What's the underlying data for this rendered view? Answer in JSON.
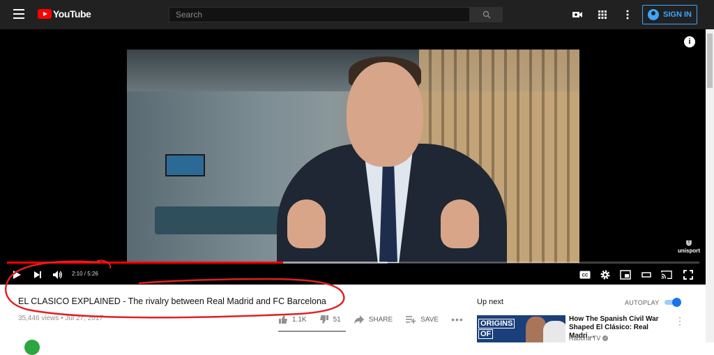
{
  "header": {
    "logo_text": "YouTube",
    "search_placeholder": "Search",
    "sign_in_label": "SIGN IN",
    "icons": [
      "menu-icon",
      "search-icon",
      "create-video-icon",
      "apps-icon",
      "more-vert-icon",
      "account-circle-icon"
    ]
  },
  "player": {
    "time_display": "2:10 / 5:26",
    "progress_fraction": 0.399,
    "buffered_fraction": 0.55,
    "watermark": "unisport",
    "info_icon": "i",
    "controls": [
      "play-icon",
      "next-icon",
      "volume-icon",
      "captions-icon",
      "settings-icon",
      "miniplayer-icon",
      "theater-icon",
      "cast-icon",
      "fullscreen-icon"
    ],
    "captions_label": "CC"
  },
  "video": {
    "title": "EL CLASICO EXPLAINED - The rivalry between Real Madrid and FC Barcelona",
    "meta": "35,446 views • Jul 27, 2017",
    "like_count": "1.1K",
    "dislike_count": "51",
    "share_label": "SHARE",
    "save_label": "SAVE",
    "more_label": "•••"
  },
  "sidebar": {
    "up_next_label": "Up next",
    "autoplay_label": "AUTOPLAY",
    "autoplay_on": true,
    "recommendation": {
      "thumbnail_text_1": "ORIGINS",
      "thumbnail_text_2": "OF",
      "title": "How The Spanish Civil War Shaped El Clásico: Real Madri…",
      "channel": "Rabona TV"
    }
  },
  "colors": {
    "header_bg": "#212121",
    "accent_blue": "#3ea6ff",
    "progress_red": "#ff0000",
    "annotation_red": "#e02020"
  }
}
